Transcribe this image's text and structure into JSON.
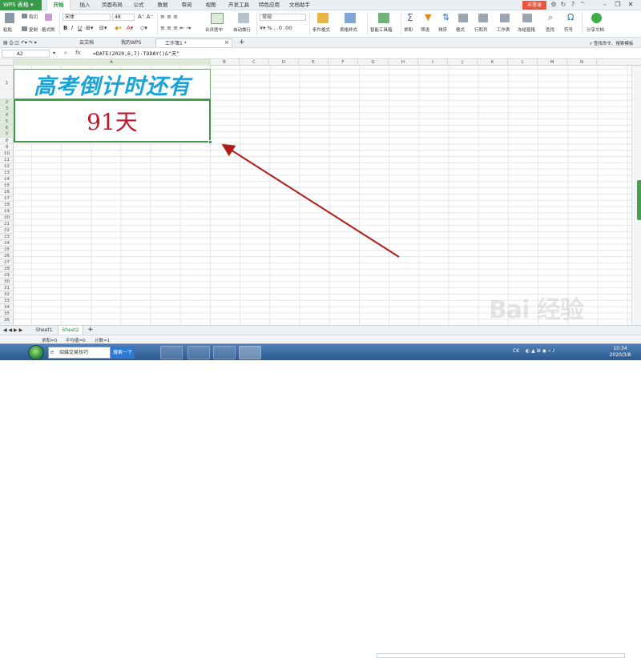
{
  "app": {
    "title": "WPS 表格",
    "login": "未登录"
  },
  "menu_tabs": [
    "开始",
    "插入",
    "页面布局",
    "公式",
    "数据",
    "审阅",
    "视图",
    "开发工具",
    "特色应用",
    "文档助手"
  ],
  "ribbon": {
    "paste": "粘贴",
    "cut": "剪切",
    "copy": "复制",
    "format_painter": "格式刷",
    "font": "宋体",
    "size": "48",
    "merge": "合并居中",
    "wrap": "自动换行",
    "number_format": "常规",
    "cond_format": "条件格式",
    "table_style": "表格样式",
    "smart_toolbox": "智能工具箱",
    "sum": "求和",
    "filter": "筛选",
    "sort": "排序",
    "format": "格式",
    "rowcol": "行和列",
    "worksheet": "工作表",
    "freeze": "冻结窗格",
    "find": "查找",
    "symbol": "符号",
    "share": "分享文档"
  },
  "doc_tabs": [
    "云文档",
    "我的WPS",
    "工作簿1 *"
  ],
  "search_hint": "查找命令、搜索模板",
  "formula_bar": {
    "name_box": "A2",
    "fx": "fx",
    "formula": "=DATE(2020,6,7)-TODAY()&\"天\""
  },
  "columns": [
    "A",
    "B",
    "C",
    "D",
    "E",
    "F",
    "G",
    "H",
    "I",
    "J",
    "K",
    "L",
    "M",
    "N"
  ],
  "rows": [
    "1",
    "2",
    "3",
    "4",
    "5",
    "6",
    "7",
    "8",
    "9",
    "10",
    "11",
    "12",
    "13",
    "14",
    "15",
    "16",
    "17",
    "18",
    "19",
    "20",
    "21",
    "22",
    "23",
    "24",
    "25",
    "26",
    "27",
    "28",
    "29",
    "30",
    "31",
    "32",
    "33",
    "34",
    "35",
    "36",
    "37",
    "38",
    "39",
    "40"
  ],
  "cells": {
    "A1": "高考倒计时还有",
    "A2": "91天"
  },
  "colors": {
    "title_text": "#1aa3d6",
    "value_text": "#c0152a",
    "accent": "#3b9a48",
    "arrow": "#b01c1c"
  },
  "sheets": [
    "Sheet1",
    "Sheet2"
  ],
  "active_sheet": "Sheet2",
  "status": {
    "sum": "求和=0",
    "avg": "平均值=0",
    "count": "计数=1"
  },
  "taskbar": {
    "search_text": "绍媒交易技巧",
    "search_btn": "搜索一下",
    "tray_lang": "CK",
    "time": "10:34",
    "date": "2020/3/8"
  },
  "watermark": "Bai 经验"
}
